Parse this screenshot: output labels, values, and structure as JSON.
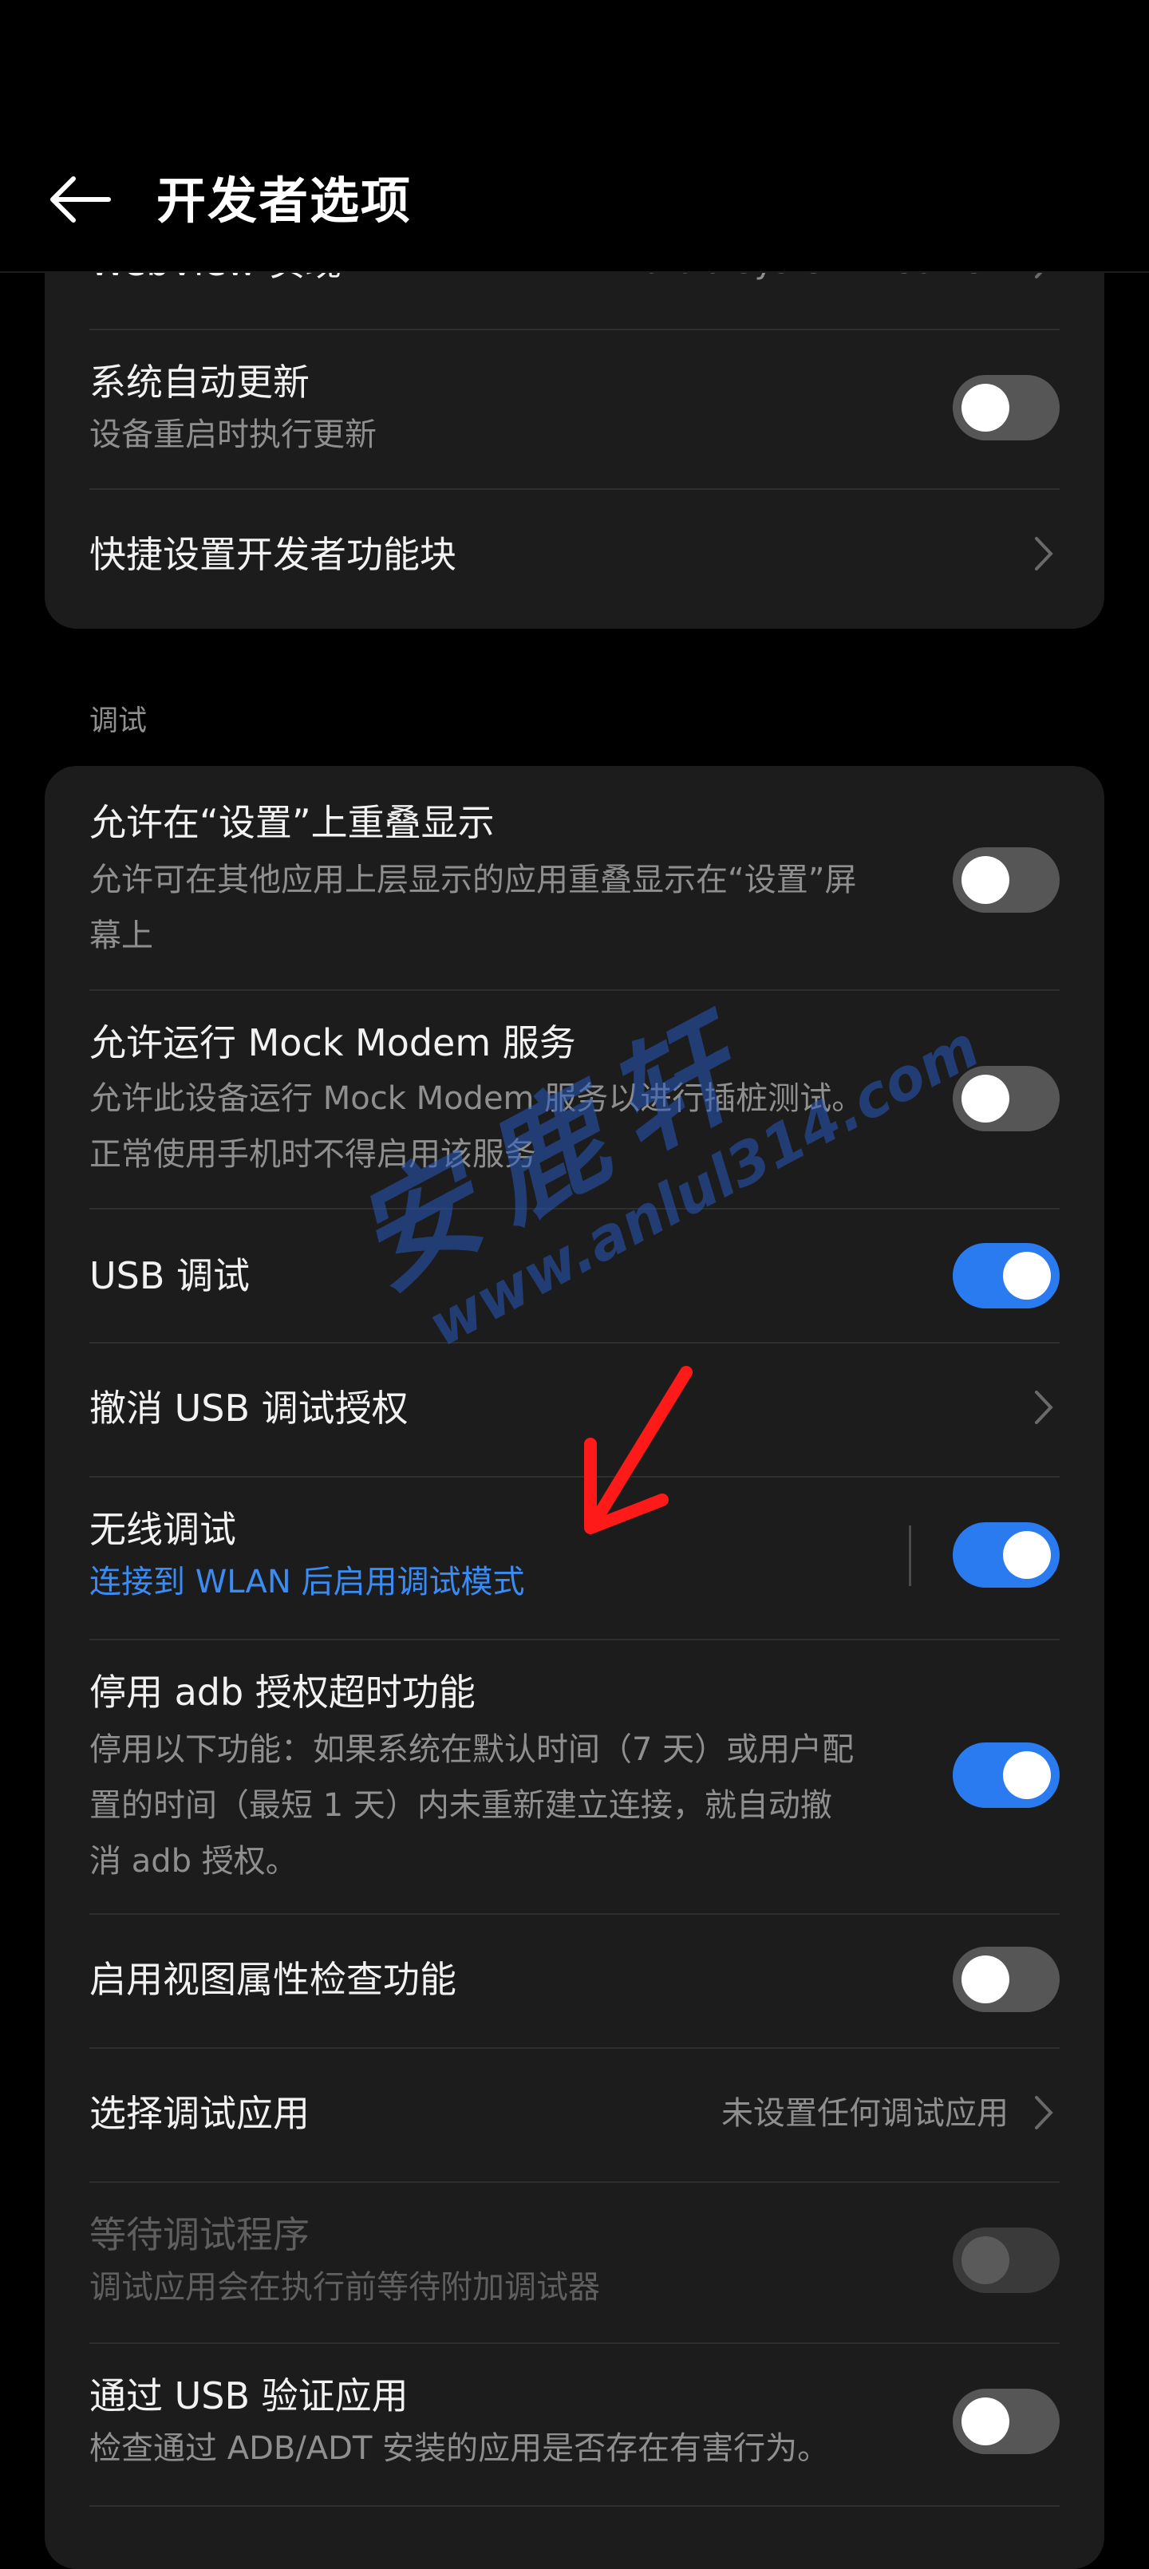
{
  "header": {
    "title": "开发者选项"
  },
  "top_card": {
    "webview": {
      "title": "WebView 实现",
      "value": "Android System WebView"
    },
    "auto_update": {
      "title": "系统自动更新",
      "subtitle": "设备重启时执行更新",
      "toggle": "off"
    },
    "quick_tiles": {
      "title": "快捷设置开发者功能块"
    }
  },
  "section": {
    "label": "调试"
  },
  "items": {
    "overlay": {
      "title": "允许在“设置”上重叠显示",
      "subtitle_1": "允许可在其他应用上层显示的应用重叠显示在“设置”屏",
      "subtitle_2": "幕上",
      "toggle": "off"
    },
    "mock_modem": {
      "title": "允许运行 Mock Modem 服务",
      "subtitle_1": "允许此设备运行 Mock Modem 服务以进行插桩测试。",
      "subtitle_2": "正常使用手机时不得启用该服务",
      "toggle": "off"
    },
    "usb_debug": {
      "title": "USB 调试",
      "toggle": "on"
    },
    "revoke_usb": {
      "title": "撤消 USB 调试授权"
    },
    "wireless_debug": {
      "title": "无线调试",
      "subtitle": "连接到 WLAN 后启用调试模式",
      "toggle": "on"
    },
    "adb_timeout": {
      "title": "停用 adb 授权超时功能",
      "subtitle_1": "停用以下功能：如果系统在默认时间（7 天）或用户配",
      "subtitle_2": "置的时间（最短 1 天）内未重新建立连接，就自动撤",
      "subtitle_3": "消 adb 授权。",
      "toggle": "on"
    },
    "view_inspect": {
      "title": "启用视图属性检查功能",
      "toggle": "off"
    },
    "debug_app": {
      "title": "选择调试应用",
      "value": "未设置任何调试应用"
    },
    "wait_debugger": {
      "title": "等待调试程序",
      "subtitle": "调试应用会在执行前等待附加调试器",
      "toggle": "off-disabled"
    },
    "verify_usb": {
      "title": "通过 USB 验证应用",
      "subtitle": "检查通过 ADB/ADT 安装的应用是否存在有害行为。",
      "toggle": "off"
    }
  },
  "watermark": {
    "text": "安鹿轩",
    "url": "www.anlul314.com"
  },
  "colors": {
    "accent": "#2b7bf0",
    "link": "#3a8cf4",
    "card": "#1c1c1c",
    "annotation_arrow": "#ff1a1a"
  }
}
